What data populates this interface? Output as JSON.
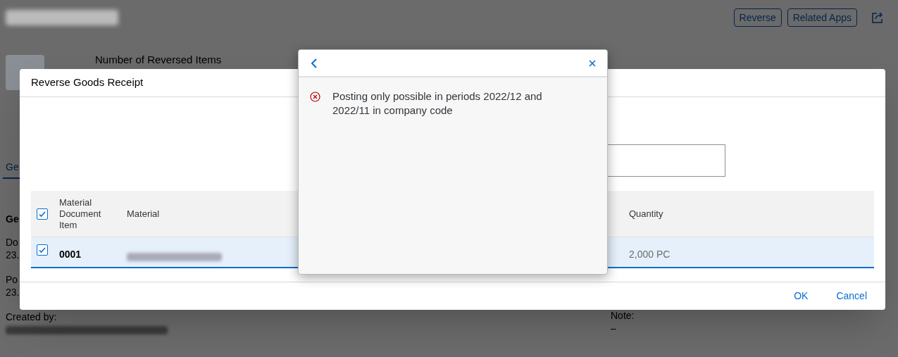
{
  "page": {
    "actions": [
      "Reverse",
      "Related Apps"
    ],
    "kpi_label": "Number of Reversed Items",
    "tabs": [
      {
        "label": "Ge",
        "selected": true
      }
    ],
    "section_title": "Ge",
    "fields": [
      {
        "label": "Do",
        "value": "23."
      },
      {
        "label": "Po",
        "value": "23."
      }
    ],
    "created_by": {
      "label": "Created by:"
    },
    "note": {
      "label": "Note:",
      "value": "–"
    }
  },
  "dialog": {
    "title": "Reverse Goods Receipt",
    "table": {
      "select_all_checked": true,
      "columns": [
        "Material Document Item",
        "Material",
        "Quantity"
      ],
      "rows": [
        {
          "selected": true,
          "item": "0001",
          "quantity": "2,000 PC"
        }
      ]
    },
    "buttons": [
      "OK",
      "Cancel"
    ]
  },
  "message_popover": {
    "messages": [
      {
        "kind": "error",
        "text": "Posting only possible in periods 2022/12 and 2022/11 in company code"
      }
    ]
  }
}
